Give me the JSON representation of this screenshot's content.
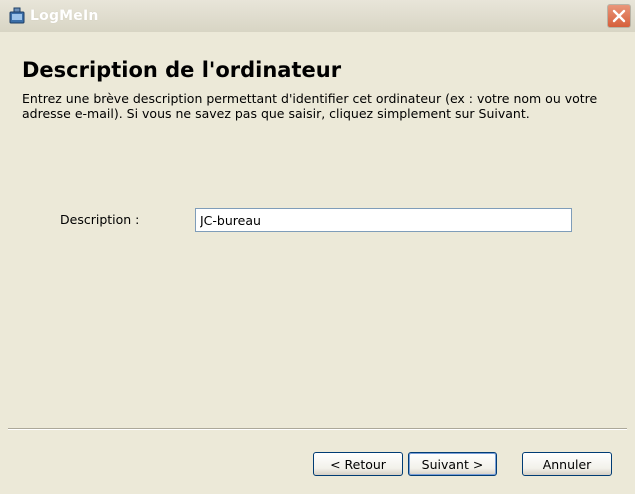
{
  "window": {
    "title": "LogMeIn",
    "close_icon": "close-icon",
    "app_icon": "logmein-app-icon"
  },
  "page": {
    "heading": "Description de l'ordinateur",
    "instructions": "Entrez une brève description permettant d'identifier cet ordinateur (ex : votre nom ou votre adresse e-mail). Si vous ne savez pas que saisir, cliquez simplement sur Suivant."
  },
  "form": {
    "description_label": "Description :",
    "description_value": "JC-bureau"
  },
  "buttons": {
    "back": "< Retour",
    "next": "Suivant >",
    "cancel": "Annuler"
  },
  "colors": {
    "window_bg": "#ECE9D8",
    "close_button": "#D65F3B",
    "default_button_border": "#003C74"
  }
}
